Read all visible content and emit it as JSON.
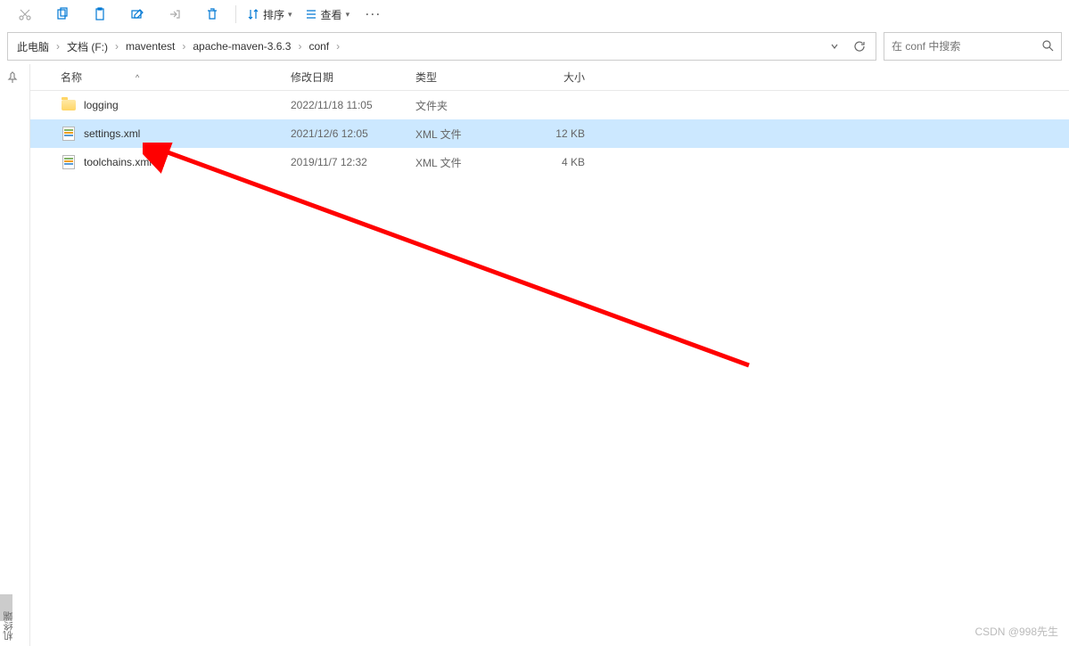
{
  "toolbar": {
    "sort_label": "排序",
    "view_label": "查看",
    "more_label": "···"
  },
  "breadcrumb": {
    "items": [
      "此电脑",
      "文档 (F:)",
      "maventest",
      "apache-maven-3.6.3",
      "conf"
    ]
  },
  "search": {
    "placeholder": "在 conf 中搜索"
  },
  "columns": {
    "name": "名称",
    "date": "修改日期",
    "type": "类型",
    "size": "大小",
    "sort_indicator": "^"
  },
  "files": [
    {
      "name": "logging",
      "date": "2022/11/18 11:05",
      "type": "文件夹",
      "size": "",
      "icon": "folder",
      "selected": false
    },
    {
      "name": "settings.xml",
      "date": "2021/12/6 12:05",
      "type": "XML 文件",
      "size": "12 KB",
      "icon": "xml",
      "selected": true
    },
    {
      "name": "toolchains.xml",
      "date": "2019/11/7 12:32",
      "type": "XML 文件",
      "size": "4 KB",
      "icon": "xml",
      "selected": false
    }
  ],
  "watermark": "CSDN @998先生",
  "bottom_label": "机终端"
}
